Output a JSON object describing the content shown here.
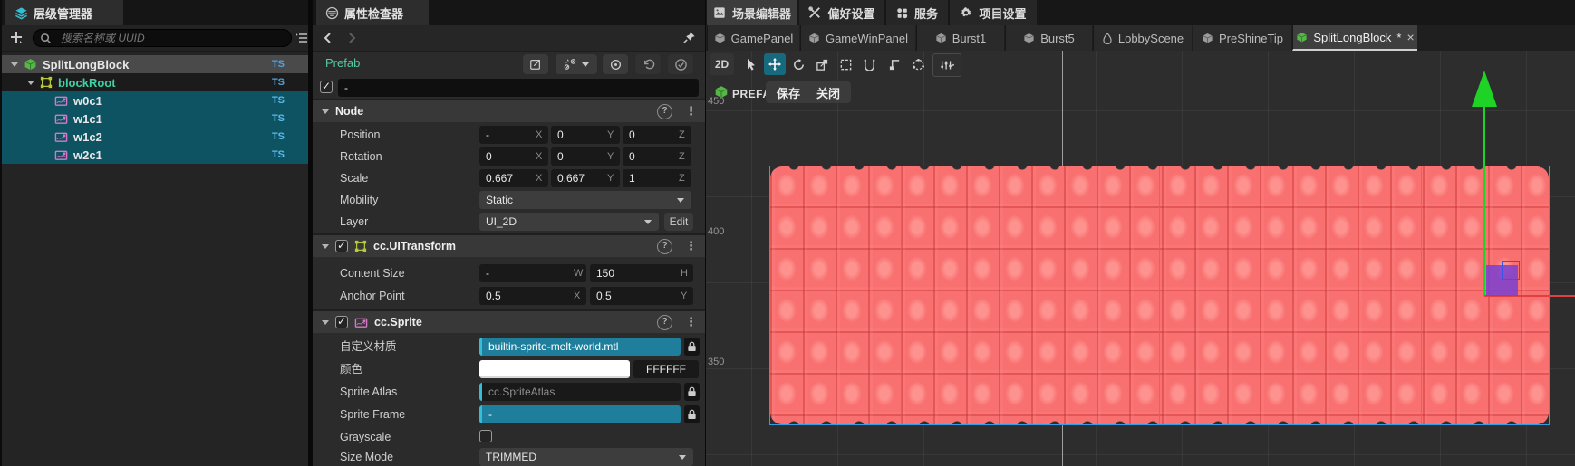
{
  "hierarchy": {
    "tab": "层级管理器",
    "search": {
      "placeholder": "搜索名称或 UUID"
    },
    "badge": "TS",
    "nodes": [
      {
        "label": "SplitLongBlock"
      },
      {
        "label": "blockRoot"
      },
      {
        "label": "w0c1"
      },
      {
        "label": "w1c1"
      },
      {
        "label": "w1c2"
      },
      {
        "label": "w2c1"
      }
    ]
  },
  "inspector": {
    "tab": "属性检查器",
    "prefab": {
      "label": "Prefab",
      "name": "-"
    },
    "axis": {
      "x": "X",
      "y": "Y",
      "z": "Z",
      "w": "W",
      "h": "H"
    },
    "node": {
      "title": "Node",
      "position": {
        "label": "Position",
        "x": "-",
        "y": "0",
        "z": "0"
      },
      "rotation": {
        "label": "Rotation",
        "x": "0",
        "y": "0",
        "z": "0"
      },
      "scale": {
        "label": "Scale",
        "x": "0.667",
        "y": "0.667",
        "z": "1"
      },
      "mobility": {
        "label": "Mobility",
        "value": "Static"
      },
      "layer": {
        "label": "Layer",
        "value": "UI_2D",
        "edit": "Edit"
      }
    },
    "uitransform": {
      "title": "cc.UITransform",
      "content_size": {
        "label": "Content Size",
        "w": "-",
        "h": "150"
      },
      "anchor_point": {
        "label": "Anchor Point",
        "x": "0.5",
        "y": "0.5"
      }
    },
    "sprite": {
      "title": "cc.Sprite",
      "custom_material": {
        "label": "自定义材质",
        "value": "builtin-sprite-melt-world.mtl"
      },
      "color": {
        "label": "颜色",
        "hex": "FFFFFF",
        "swatch": "#ffffff"
      },
      "sprite_atlas": {
        "label": "Sprite Atlas",
        "value": "cc.SpriteAtlas"
      },
      "sprite_frame": {
        "label": "Sprite Frame",
        "value": "-"
      },
      "grayscale": {
        "label": "Grayscale"
      },
      "size_mode": {
        "label": "Size Mode",
        "value": "TRIMMED"
      }
    }
  },
  "scene": {
    "menu": {
      "editor": "场景编辑器",
      "preferences": "偏好设置",
      "services": "服务",
      "project": "项目设置"
    },
    "tabs": [
      {
        "label": "GamePanel"
      },
      {
        "label": "GameWinPanel"
      },
      {
        "label": "Burst1"
      },
      {
        "label": "Burst5"
      },
      {
        "label": "LobbyScene"
      },
      {
        "label": "PreShineTip"
      },
      {
        "label": "SplitLongBlock",
        "dirty": "*",
        "close": "×"
      }
    ],
    "toolbar": {
      "mode": "2D"
    },
    "prefab_bar": {
      "badge": "PREFAB",
      "save": "保存",
      "close": "关闭"
    },
    "ruler": {
      "r450": "450",
      "r400": "400",
      "r350": "350"
    },
    "colors": {
      "selection": "#2e9fe6",
      "axis_y": "#1fd326",
      "axis_x": "#e04040",
      "plane_handle": "#7a3fd0"
    }
  }
}
